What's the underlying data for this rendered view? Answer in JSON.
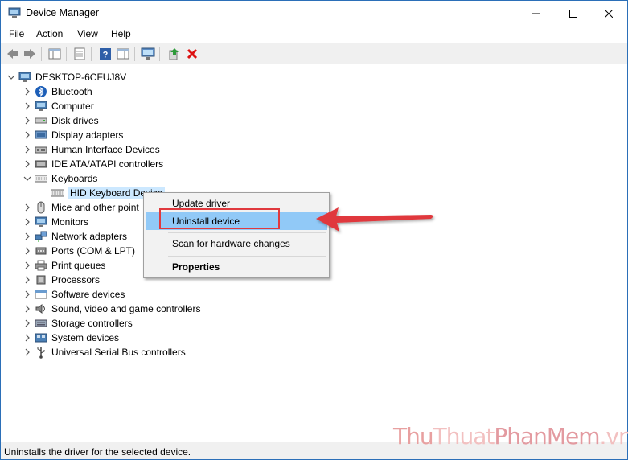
{
  "window": {
    "title": "Device Manager"
  },
  "menu": [
    "File",
    "Action",
    "View",
    "Help"
  ],
  "tree": {
    "root": "DESKTOP-6CFUJ8V",
    "categories": [
      {
        "label": "Bluetooth",
        "icon": "bluetooth-icon"
      },
      {
        "label": "Computer",
        "icon": "computer-icon"
      },
      {
        "label": "Disk drives",
        "icon": "disk-drive-icon"
      },
      {
        "label": "Display adapters",
        "icon": "display-adapter-icon"
      },
      {
        "label": "Human Interface Devices",
        "icon": "hid-icon"
      },
      {
        "label": "IDE ATA/ATAPI controllers",
        "icon": "ide-controller-icon"
      },
      {
        "label": "Keyboards",
        "icon": "keyboard-icon",
        "expanded": true
      },
      {
        "label": "Mice and other point",
        "icon": "mouse-icon"
      },
      {
        "label": "Monitors",
        "icon": "monitor-icon"
      },
      {
        "label": "Network adapters",
        "icon": "network-adapter-icon"
      },
      {
        "label": "Ports (COM & LPT)",
        "icon": "port-icon"
      },
      {
        "label": "Print queues",
        "icon": "printer-icon"
      },
      {
        "label": "Processors",
        "icon": "processor-icon"
      },
      {
        "label": "Software devices",
        "icon": "software-device-icon"
      },
      {
        "label": "Sound, video and game controllers",
        "icon": "sound-icon"
      },
      {
        "label": "Storage controllers",
        "icon": "storage-icon"
      },
      {
        "label": "System devices",
        "icon": "system-device-icon"
      },
      {
        "label": "Universal Serial Bus controllers",
        "icon": "usb-icon"
      }
    ],
    "keyboard_child": "HID Keyboard Device"
  },
  "context_menu": {
    "update": "Update driver",
    "uninstall": "Uninstall device",
    "scan": "Scan for hardware changes",
    "properties": "Properties"
  },
  "status": "Uninstalls the driver for the selected device.",
  "watermark": {
    "part1": "Thu",
    "part2": "Thuat",
    "part3": "PhanMem",
    "part4": ".vn"
  },
  "colors": {
    "highlight": "#91c9f7",
    "annotation_red": "#e0393e",
    "selection": "#cce8ff"
  }
}
